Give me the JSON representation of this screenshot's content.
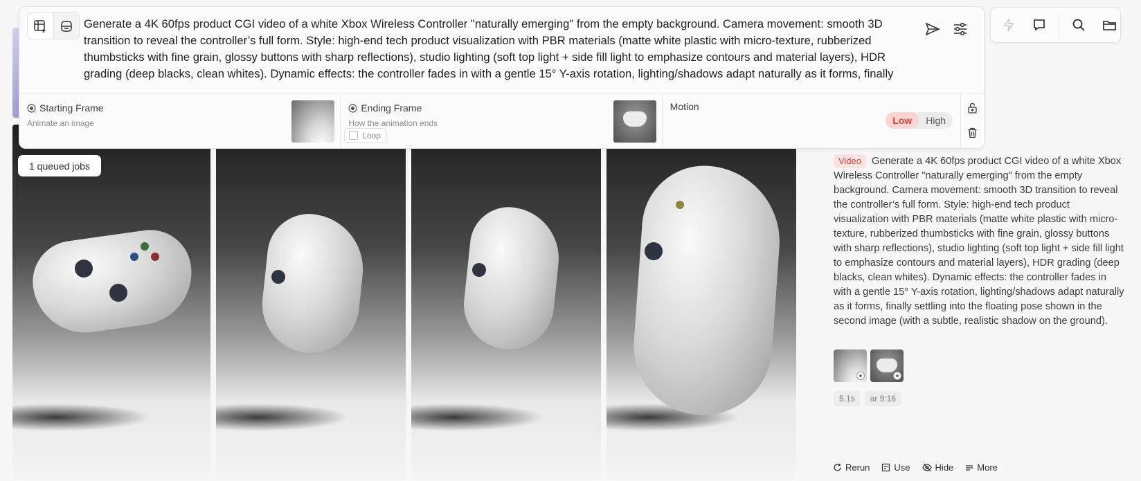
{
  "prompt": {
    "text": "Generate a 4K 60fps product CGI video of a white Xbox Wireless Controller \"naturally emerging\" from the empty background. Camera movement: smooth 3D transition to reveal the controller’s full form. Style: high-end tech product visualization with PBR materials (matte white plastic with micro-texture, rubberized thumbsticks with fine grain, glossy buttons with sharp reflections), studio lighting (soft top light + side fill light to emphasize contours and material layers), HDR grading (deep blacks, clean whites). Dynamic effects: the controller fades in with a gentle 15° Y-axis rotation, lighting/shadows adapt naturally as it forms, finally"
  },
  "frames": {
    "start": {
      "title": "Starting Frame",
      "subtitle": "Animate an image"
    },
    "end": {
      "title": "Ending Frame",
      "subtitle": "How the animation ends",
      "loop_label": "Loop"
    },
    "motion": {
      "title": "Motion",
      "options": [
        "Low",
        "High"
      ],
      "selected": "Low"
    }
  },
  "gallery": {
    "queue_badge": "1 queued jobs",
    "frame_count": 4
  },
  "details": {
    "tag": "Video",
    "text": "Generate a 4K 60fps product CGI video of a white Xbox Wireless Controller \"naturally emerging\" from the empty background. Camera movement: smooth 3D transition to reveal the controller’s full form. Style: high-end tech product visualization with PBR materials (matte white plastic with micro-texture, rubberized thumbsticks with fine grain, glossy buttons with sharp reflections), studio lighting (soft top light + side fill light to emphasize contours and material layers), HDR grading (deep blacks, clean whites). Dynamic effects: the controller fades in with a gentle 15° Y-axis rotation, lighting/shadows adapt naturally as it forms, finally settling into the floating pose shown in the second image (with a subtle, realistic shadow on the ground).",
    "chips": [
      "5.1s",
      "ar 9:16"
    ],
    "actions": [
      "Rerun",
      "Use",
      "Hide",
      "More"
    ]
  },
  "colors": {
    "accent": "#d4473b",
    "accent_bg": "#fcd5d2"
  },
  "icons": {
    "toolbar": [
      "bolt-icon",
      "chat-icon",
      "search-icon",
      "folder-icon"
    ],
    "card": [
      "send-icon",
      "settings-sliders-icon",
      "unlock-icon",
      "trash-icon"
    ]
  }
}
